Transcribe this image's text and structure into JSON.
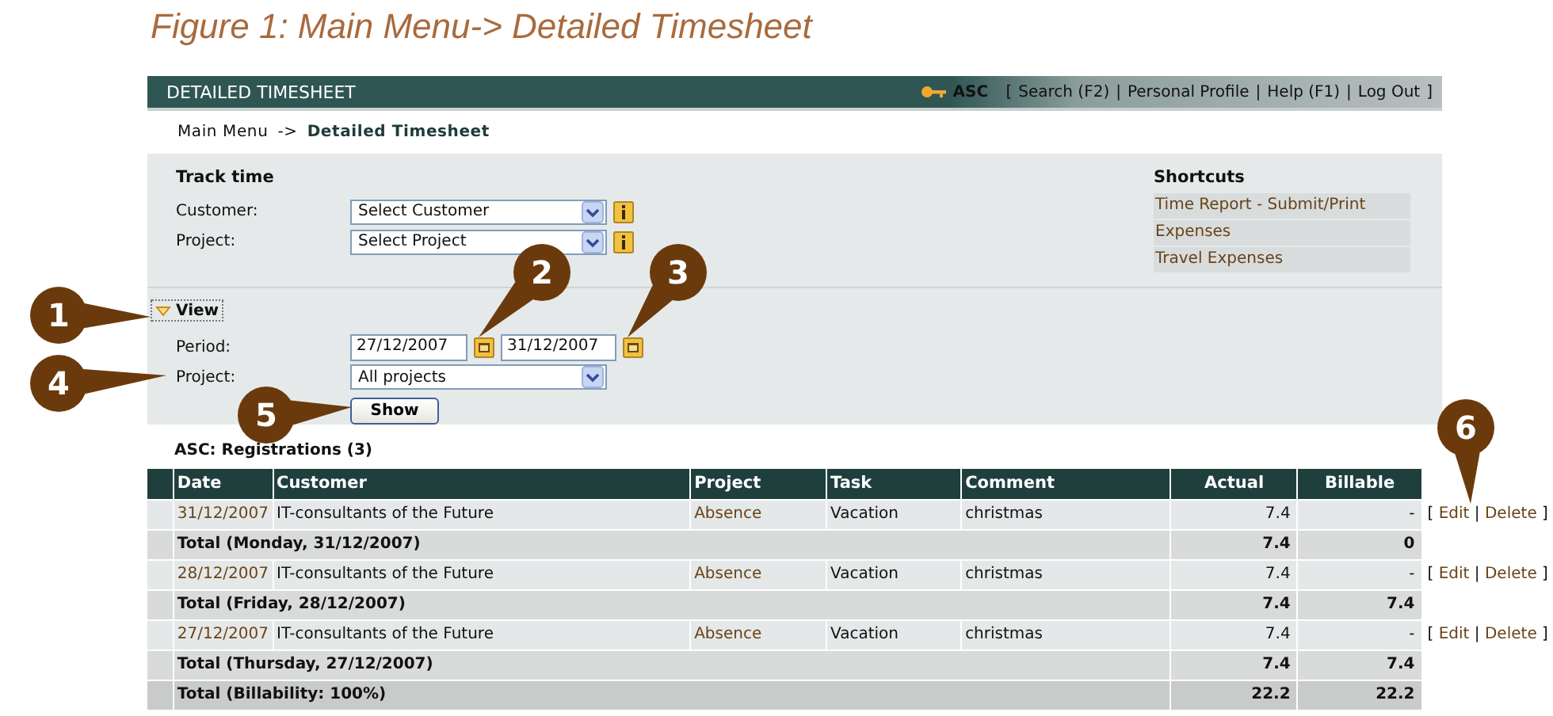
{
  "figure_caption": "Figure 1: Main Menu-> Detailed Timesheet",
  "header": {
    "title": "DETAILED TIMESHEET",
    "user": "ASC",
    "open": "[",
    "close": "]",
    "links": [
      {
        "label": "Search (F2)"
      },
      {
        "sep": "|",
        "label": "Personal Profile"
      },
      {
        "sep": "|",
        "label": "Help (F1)"
      },
      {
        "sep": "|",
        "label": "Log Out"
      }
    ]
  },
  "breadcrumb": {
    "items": [
      "Main Menu",
      "Detailed Timesheet"
    ],
    "separator": "->"
  },
  "track_time": {
    "title": "Track time",
    "fields": [
      {
        "label": "Customer:",
        "value": "Select Customer"
      },
      {
        "label": "Project:",
        "value": "Select Project"
      }
    ]
  },
  "shortcuts": {
    "title": "Shortcuts",
    "items": [
      "Time Report - Submit/Print",
      "Expenses",
      "Travel Expenses"
    ]
  },
  "view": {
    "label": "View",
    "expanded": true,
    "period_label": "Period:",
    "period_from": "27/12/2007",
    "period_to": "31/12/2007",
    "project_label": "Project:",
    "project_value": "All projects",
    "button": "Show"
  },
  "registrations": {
    "title": "ASC: Registrations (3)",
    "columns": [
      "Date",
      "Customer",
      "Project",
      "Task",
      "Comment",
      "Actual",
      "Billable"
    ],
    "rows": [
      {
        "kind": "entry",
        "date": "31/12/2007",
        "customer": "IT-consultants of the Future",
        "project": "Absence",
        "task": "Vacation",
        "comment": "christmas",
        "actual": "7.4",
        "billable": "-",
        "actions": {
          "open": "[",
          "edit": "Edit",
          "sep": "|",
          "delete": "Delete",
          "close": "]"
        }
      },
      {
        "kind": "total",
        "label": "Total (Monday, 31/12/2007)",
        "actual": "7.4",
        "billable": "0"
      },
      {
        "kind": "entry",
        "date": "28/12/2007",
        "customer": "IT-consultants of the Future",
        "project": "Absence",
        "task": "Vacation",
        "comment": "christmas",
        "actual": "7.4",
        "billable": "-",
        "actions": {
          "open": "[",
          "edit": "Edit",
          "sep": "|",
          "delete": "Delete",
          "close": "]"
        }
      },
      {
        "kind": "total",
        "label": "Total (Friday, 28/12/2007)",
        "actual": "7.4",
        "billable": "7.4"
      },
      {
        "kind": "entry",
        "date": "27/12/2007",
        "customer": "IT-consultants of the Future",
        "project": "Absence",
        "task": "Vacation",
        "comment": "christmas",
        "actual": "7.4",
        "billable": "-",
        "actions": {
          "open": "[",
          "edit": "Edit",
          "sep": "|",
          "delete": "Delete",
          "close": "]"
        }
      },
      {
        "kind": "total",
        "label": "Total (Thursday, 27/12/2007)",
        "actual": "7.4",
        "billable": "7.4"
      },
      {
        "kind": "grand_total",
        "label": "Total (Billability: 100%)",
        "actual": "22.2",
        "billable": "22.2"
      }
    ]
  },
  "callouts": [
    "1",
    "2",
    "3",
    "4",
    "5",
    "6"
  ]
}
